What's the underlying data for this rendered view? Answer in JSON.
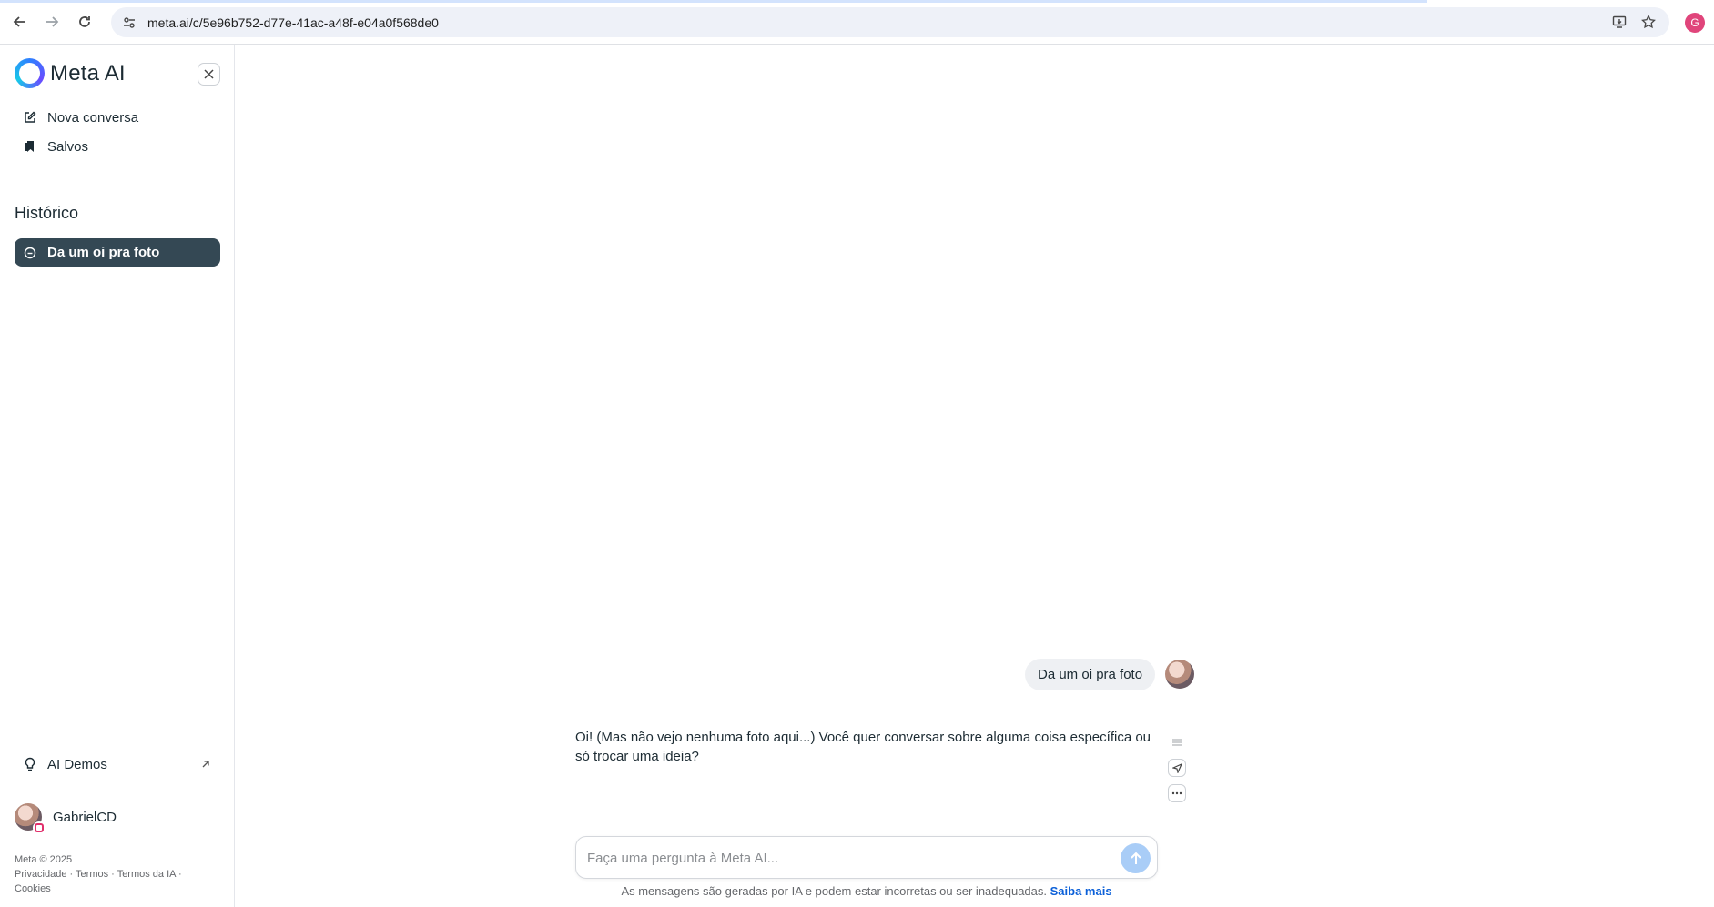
{
  "browser": {
    "url": "meta.ai/c/5e96b752-d77e-41ac-a48f-e04a0f568de0",
    "profile_initial": "G"
  },
  "sidebar": {
    "logo_text": "Meta AI",
    "items": [
      {
        "label": "Nova conversa",
        "icon": "edit-icon"
      },
      {
        "label": "Salvos",
        "icon": "bookmark-icon"
      }
    ],
    "history_title": "Histórico",
    "history_items": [
      {
        "label": "Da um oi pra foto",
        "active": true
      }
    ],
    "demos_label": "AI Demos",
    "user_name": "GabrielCD",
    "footer_line1": "Meta © 2025",
    "footer_links": "Privacidade · Termos · Termos da IA · Cookies"
  },
  "chat": {
    "user_message": "Da um oi pra foto",
    "ai_message": "Oi! (Mas não vejo nenhuma foto aqui...) Você quer conversar sobre alguma coisa específica ou só trocar uma ideia?",
    "composer_placeholder": "Faça uma pergunta à Meta AI...",
    "disclaimer": "As mensagens são geradas por IA e podem estar incorretas ou ser inadequadas.",
    "disclaimer_link": "Saiba mais"
  },
  "colors": {
    "active_history_bg": "#344854",
    "send_button": "#a9cdf7",
    "link": "#0a5fd8"
  }
}
